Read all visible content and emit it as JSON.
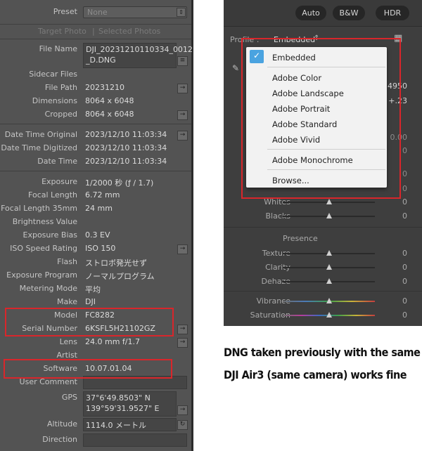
{
  "left_panel": {
    "preset": {
      "label": "Preset",
      "value": "None"
    },
    "tabs": {
      "target": "Target Photo",
      "selected": "Selected Photos"
    },
    "rows": [
      {
        "label": "File Name",
        "value": "DJI_20231210110334_0012\n_D.DNG"
      },
      {
        "label": "Sidecar Files",
        "value": ""
      },
      {
        "label": "File Path",
        "value": "20231210"
      },
      {
        "label": "Dimensions",
        "value": "8064 x 6048"
      },
      {
        "label": "Cropped",
        "value": "8064 x 6048"
      },
      {
        "label": "Date Time Original",
        "value": "2023/12/10 11:03:34"
      },
      {
        "label": "Date Time Digitized",
        "value": "2023/12/10 11:03:34"
      },
      {
        "label": "Date Time",
        "value": "2023/12/10 11:03:34"
      },
      {
        "label": "Exposure",
        "value": "1/2000 秒 (ƒ / 1.7)"
      },
      {
        "label": "Focal Length",
        "value": "6.72 mm"
      },
      {
        "label": "Focal Length 35mm",
        "value": "24 mm"
      },
      {
        "label": "Brightness Value",
        "value": ""
      },
      {
        "label": "Exposure Bias",
        "value": "0.3 EV"
      },
      {
        "label": "ISO Speed Rating",
        "value": "ISO 150"
      },
      {
        "label": "Flash",
        "value": "ストロボ発光せず"
      },
      {
        "label": "Exposure Program",
        "value": "ノーマルプログラム"
      },
      {
        "label": "Metering Mode",
        "value": "平均"
      },
      {
        "label": "Make",
        "value": "DJI"
      },
      {
        "label": "Model",
        "value": "FC8282"
      },
      {
        "label": "Serial Number",
        "value": "6KSFL5H21102GZ"
      },
      {
        "label": "Lens",
        "value": "24.0 mm f/1.7"
      },
      {
        "label": "Artist",
        "value": ""
      },
      {
        "label": "Software",
        "value": "10.07.01.04"
      },
      {
        "label": "User Comment",
        "value": ""
      },
      {
        "label": "GPS",
        "value": "37°6'49.8503\" N\n139°59'31.9527\" E"
      },
      {
        "label": "Altitude",
        "value": "1114.0 メートル"
      },
      {
        "label": "Direction",
        "value": ""
      }
    ]
  },
  "right_panel": {
    "buttons": [
      "Auto",
      "B&W",
      "HDR"
    ],
    "profile": {
      "label": "Profile :",
      "value": "Embedded"
    },
    "partial_values": [
      "4950",
      "+.23",
      "0.00",
      "0",
      "0",
      "0"
    ],
    "menu_items": [
      "Embedded",
      "Adobe Color",
      "Adobe Landscape",
      "Adobe Portrait",
      "Adobe Standard",
      "Adobe Vivid",
      "Adobe Monochrome",
      "Browse..."
    ],
    "sliders_top": [
      {
        "label": "Whites",
        "value": "0"
      },
      {
        "label": "Blacks",
        "value": "0"
      }
    ],
    "section_presence": "Presence",
    "sliders_presence": [
      {
        "label": "Texture",
        "value": "0"
      },
      {
        "label": "Clarity",
        "value": "0"
      },
      {
        "label": "Dehaze",
        "value": "0"
      },
      {
        "label": "Vibrance",
        "value": "0"
      },
      {
        "label": "Saturation",
        "value": "0"
      }
    ]
  },
  "caption": {
    "line1": "DNG taken previously with the same",
    "line2": "DJI Air3 (same camera) works fine"
  },
  "colors": {
    "highlight_box": "#d9262b",
    "check_accent": "#4aa3e0"
  }
}
